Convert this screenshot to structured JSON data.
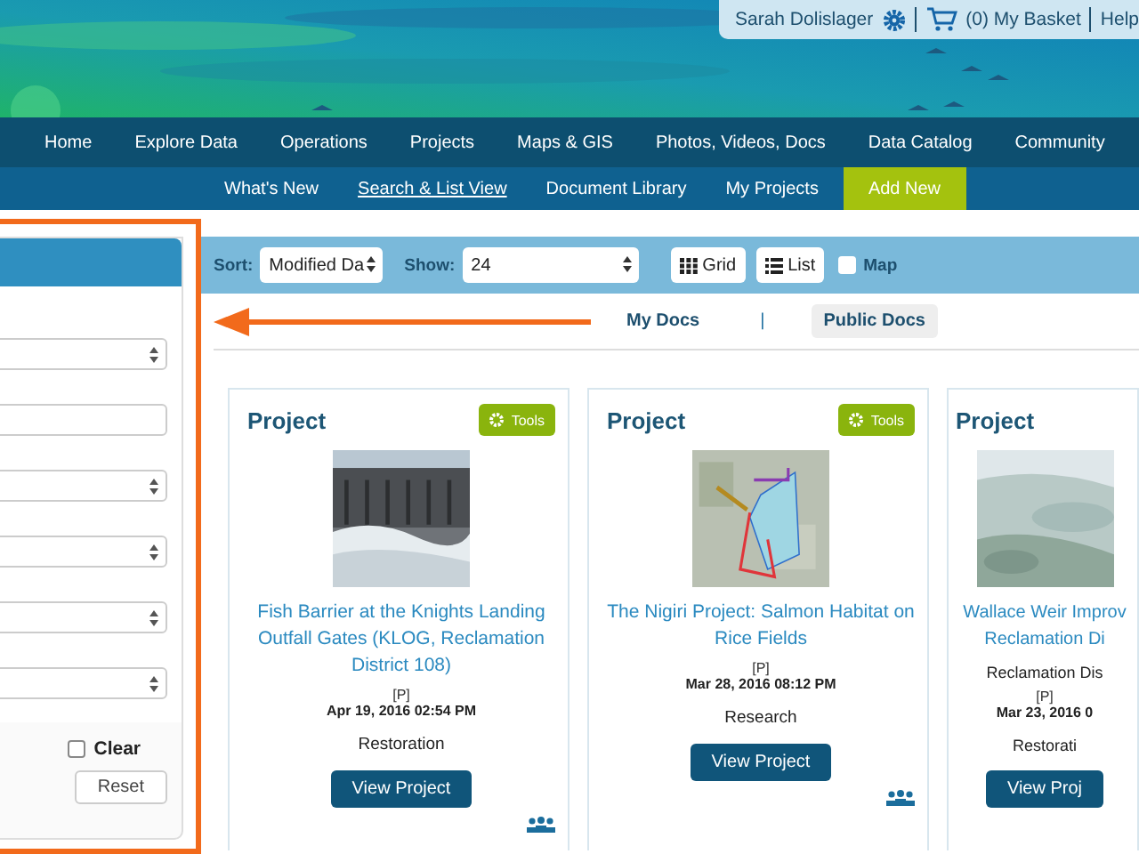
{
  "user_bar": {
    "user": "Sarah Dolislager",
    "basket": "(0) My Basket",
    "help": "Help"
  },
  "nav": [
    "Home",
    "Explore Data",
    "Operations",
    "Projects",
    "Maps & GIS",
    "Photos, Videos, Docs",
    "Data Catalog",
    "Community"
  ],
  "subnav": [
    {
      "label": "What's New",
      "selected": false,
      "kind": "link"
    },
    {
      "label": "Search & List View",
      "selected": true,
      "kind": "link"
    },
    {
      "label": "Document Library",
      "selected": false,
      "kind": "link"
    },
    {
      "label": "My Projects",
      "selected": false,
      "kind": "link"
    },
    {
      "label": "Add New",
      "selected": false,
      "kind": "action"
    }
  ],
  "filter_panel": {
    "fields": [
      {
        "kind": "select"
      },
      {
        "kind": "input"
      },
      {
        "kind": "select"
      },
      {
        "kind": "select"
      },
      {
        "kind": "select"
      },
      {
        "kind": "select"
      }
    ],
    "clear": {
      "label": "Clear",
      "checked": false
    },
    "reset": "Reset"
  },
  "toolbar": {
    "sort_label": "Sort:",
    "sort_value": "Modified Da",
    "show_label": "Show:",
    "show_value": "24",
    "grid": "Grid",
    "list": "List",
    "map": {
      "label": "Map",
      "checked": false
    }
  },
  "doc_tabs": [
    {
      "label": "My Docs",
      "selected": false
    },
    {
      "label": "Public Docs",
      "selected": true
    }
  ],
  "doc_tab_separator": "|",
  "cards": [
    {
      "type": "Project",
      "tools": "Tools",
      "title": "Fish Barrier at the Knights Landing Outfall Gates (KLOG, Reclamation District 108)",
      "code": "[P]",
      "date": "Apr 19, 2016 02:54 PM",
      "category": "Restoration",
      "button": "View Project",
      "group_icon": true
    },
    {
      "type": "Project",
      "tools": "Tools",
      "title": "The Nigiri Project: Salmon Habitat on Rice Fields",
      "code": "[P]",
      "date": "Mar 28, 2016 08:12 PM",
      "category": "Research",
      "button": "View Project",
      "group_icon": true
    },
    {
      "type": "Project",
      "title": "Wallace Weir Improv Reclamation Di",
      "org": "Reclamation Dis",
      "code": "[P]",
      "date": "Mar 23, 2016 0",
      "category": "Restorati",
      "button": "View Proj",
      "group_icon": false
    }
  ]
}
